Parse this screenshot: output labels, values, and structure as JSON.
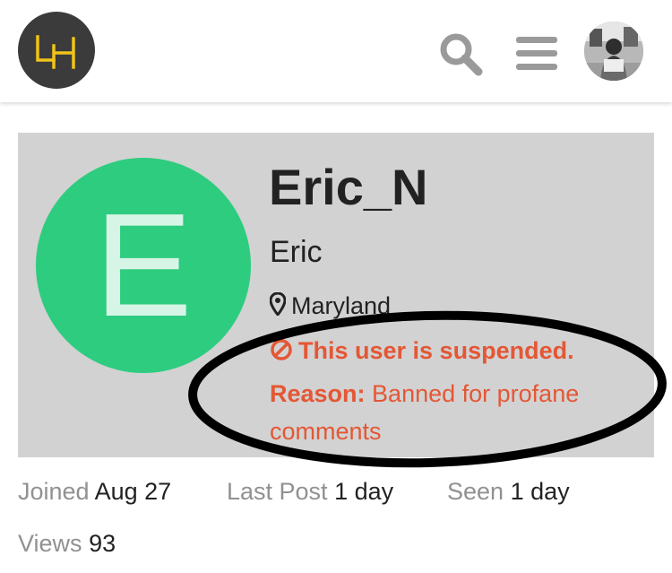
{
  "header": {
    "logo_text": "LH",
    "search_icon": "search-icon",
    "menu_icon": "hamburger-menu-icon",
    "avatar_icon": "user-avatar"
  },
  "profile": {
    "avatar_letter": "E",
    "avatar_color": "#2ecc7f",
    "username": "Eric_N",
    "full_name": "Eric",
    "location": "Maryland",
    "suspended_message": "This user is suspended.",
    "reason_label": "Reason:",
    "reason_text": "Banned for profane comments"
  },
  "stats": {
    "joined_label": "Joined",
    "joined_value": "Aug 27",
    "last_post_label": "Last Post",
    "last_post_value": "1 day",
    "seen_label": "Seen",
    "seen_value": "1 day",
    "views_label": "Views",
    "views_value": "93"
  },
  "colors": {
    "suspended": "#e45735",
    "card_bg": "#d2d2d2",
    "logo_bg": "#3b3b3b",
    "logo_mark": "#f0c419"
  }
}
